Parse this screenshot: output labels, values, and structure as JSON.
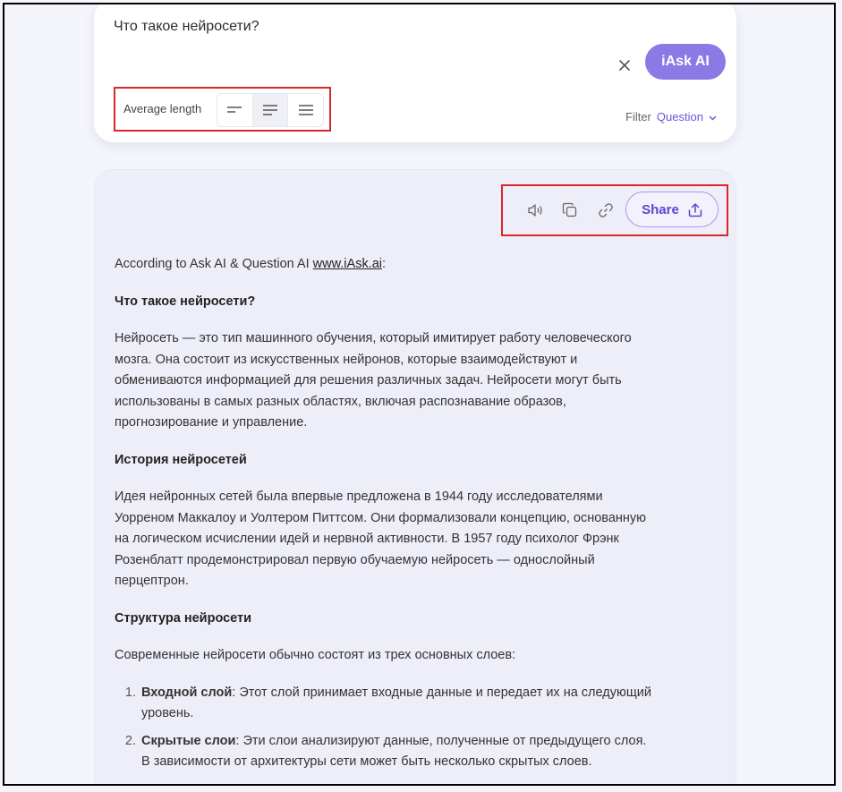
{
  "search": {
    "query": "Что такое нейросети?",
    "ask_button": "iAsk AI",
    "length_label": "Average length",
    "filter_label": "Filter",
    "filter_value": "Question"
  },
  "answer": {
    "intro_prefix": "According to Ask AI & Question AI ",
    "intro_link": "www.iAsk.ai",
    "intro_suffix": ":",
    "share_label": "Share",
    "h1": "Что такое нейросети?",
    "p1": "Нейросеть — это тип машинного обучения, который имитирует работу человеческого мозга. Она состоит из искусственных нейронов, которые взаимодействуют и обмениваются информацией для решения различных задач. Нейросети могут быть использованы в самых разных областях, включая распознавание образов, прогнозирование и управление.",
    "h2": "История нейросетей",
    "p2": "Идея нейронных сетей была впервые предложена в 1944 году исследователями Уорреном Маккалоу и Уолтером Питтсом. Они формализовали концепцию, основанную на логическом исчислении идей и нервной активности. В 1957 году психолог Фрэнк Розенблатт продемонстрировал первую обучаемую нейросеть — однослойный перцептрон.",
    "h3": "Структура нейросети",
    "p3": "Современные нейросети обычно состоят из трех основных слоев:",
    "list": [
      {
        "term": "Входной слой",
        "text": ": Этот слой принимает входные данные и передает их на следующий уровень."
      },
      {
        "term": "Скрытые слои",
        "text": ": Эти слои анализируют данные, полученные от предыдущего слоя. В зависимости от архитектуры сети может быть несколько скрытых слоев."
      }
    ]
  },
  "colors": {
    "accent": "#8b79e6",
    "highlight_box": "#d9262b"
  },
  "icons": [
    "close-icon",
    "align-short-icon",
    "align-medium-icon",
    "align-long-icon",
    "chevron-down-icon",
    "speaker-icon",
    "copy-icon",
    "link-icon",
    "upload-icon"
  ]
}
